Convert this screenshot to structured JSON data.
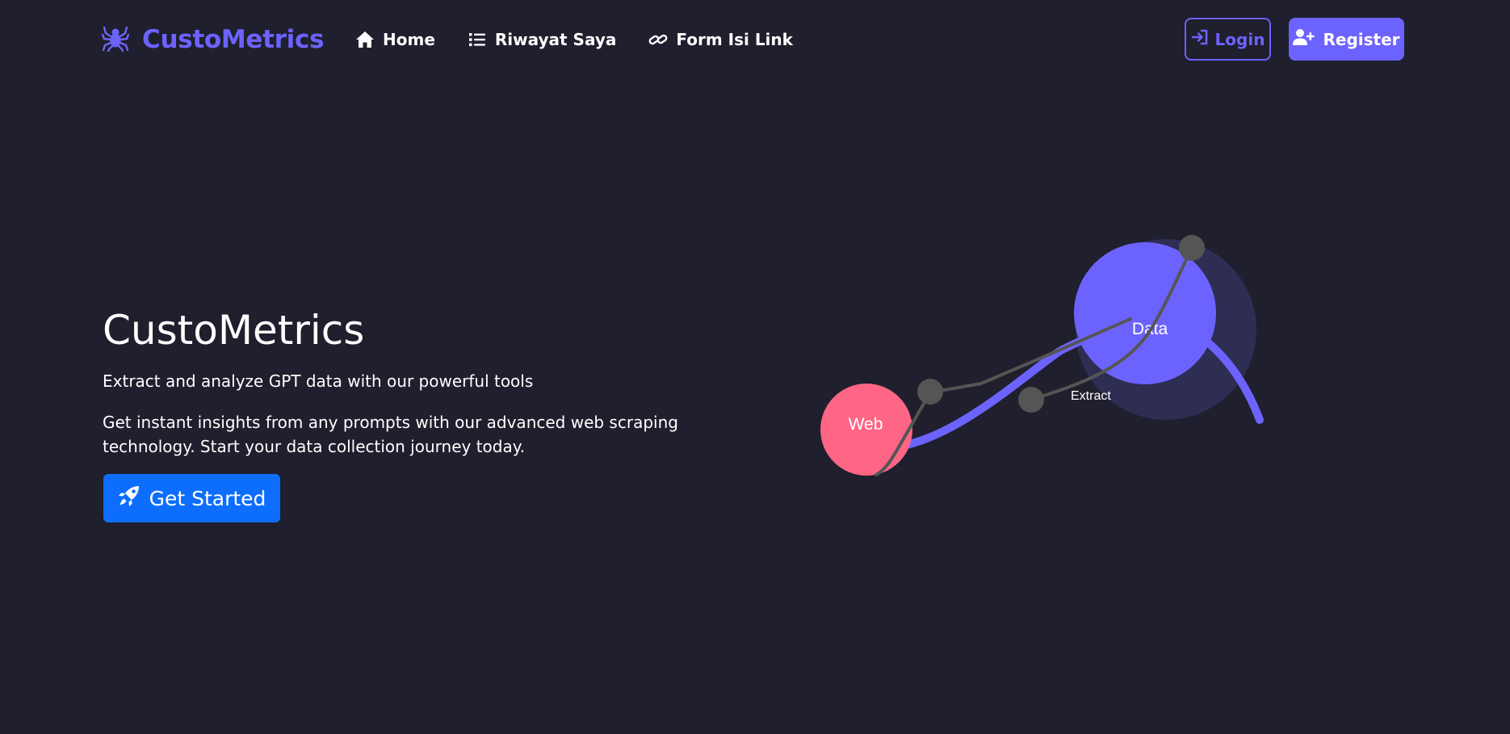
{
  "navbar": {
    "brand": {
      "icon": "spider-icon",
      "name": "CustoMetrics"
    },
    "links": [
      {
        "icon": "home-icon",
        "label": "Home"
      },
      {
        "icon": "list-icon",
        "label": "Riwayat Saya"
      },
      {
        "icon": "link-icon",
        "label": "Form Isi Link"
      }
    ],
    "login": {
      "icon": "sign-in-icon",
      "label": "Login"
    },
    "register": {
      "icon": "user-plus-icon",
      "label": "Register"
    }
  },
  "hero": {
    "title": "CustoMetrics",
    "subtitle": "Extract and analyze GPT data with our powerful tools",
    "description": "Get instant insights from any prompts with our advanced web scraping technology. Start your data collection journey today.",
    "cta": {
      "icon": "rocket-icon",
      "label": "Get Started"
    }
  },
  "illustration": {
    "nodes": {
      "web": "Web",
      "data": "Data",
      "extract": "Extract"
    }
  },
  "colors": {
    "background": "#1f1f2d",
    "accent": "#6c63ff",
    "primary_button": "#0d6efd",
    "web_node": "#ff6584",
    "connector": "#555555"
  }
}
